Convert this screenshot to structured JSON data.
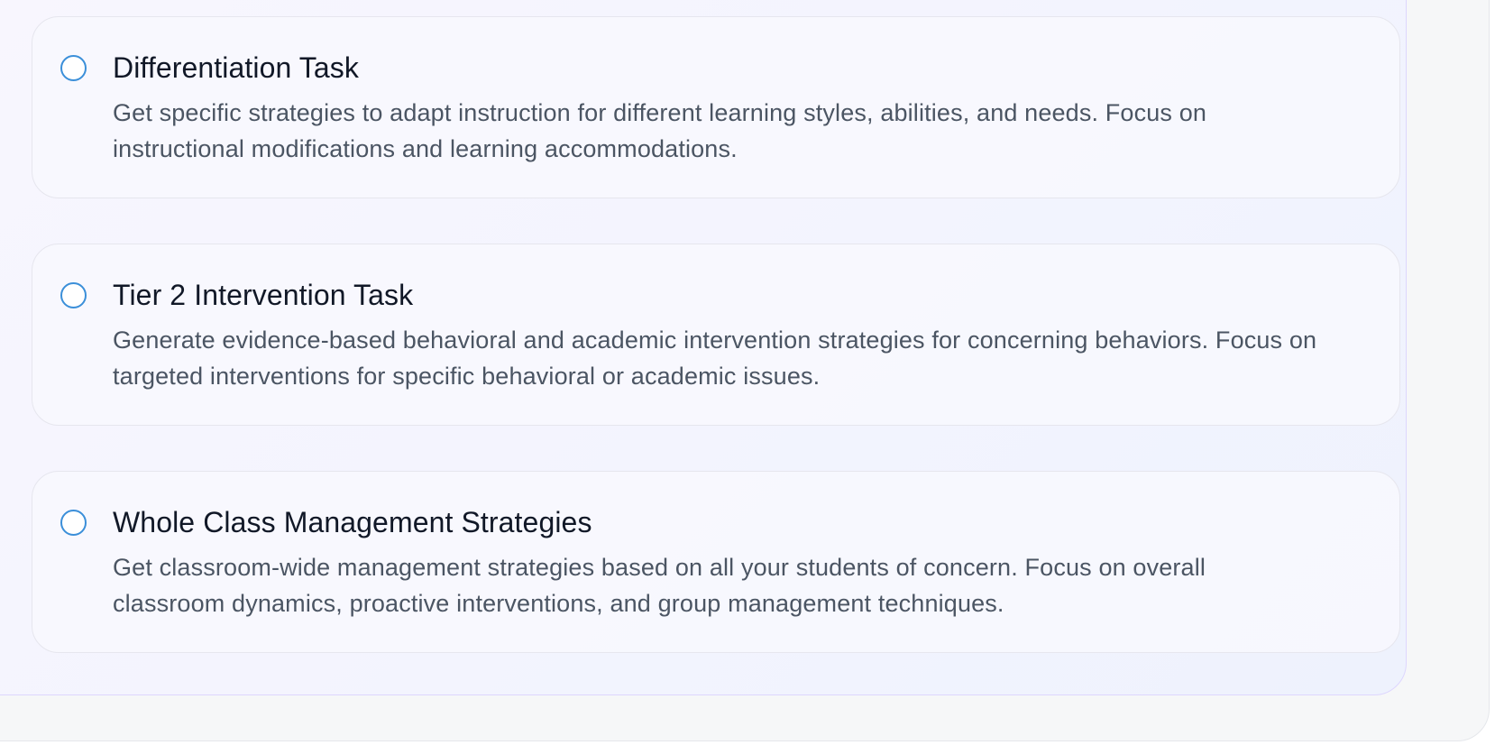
{
  "task_options": [
    {
      "title": "Differentiation Task",
      "description": "Get specific strategies to adapt instruction for different learning styles, abilities, and needs. Focus on instructional modifications and learning accommodations.",
      "selected": false
    },
    {
      "title": "Tier 2 Intervention Task",
      "description": "Generate evidence-based behavioral and academic intervention strategies for concerning behaviors. Focus on targeted interventions for specific behavioral or academic issues.",
      "selected": false
    },
    {
      "title": "Whole Class Management Strategies",
      "description": "Get classroom-wide management strategies based on all your students of concern. Focus on overall classroom dynamics, proactive interventions, and group management techniques.",
      "selected": false
    }
  ],
  "colors": {
    "radio_border": "#3b8fd9",
    "title_text": "#111827",
    "description_text": "#4b5563",
    "panel_border": "#ddd6fe"
  }
}
